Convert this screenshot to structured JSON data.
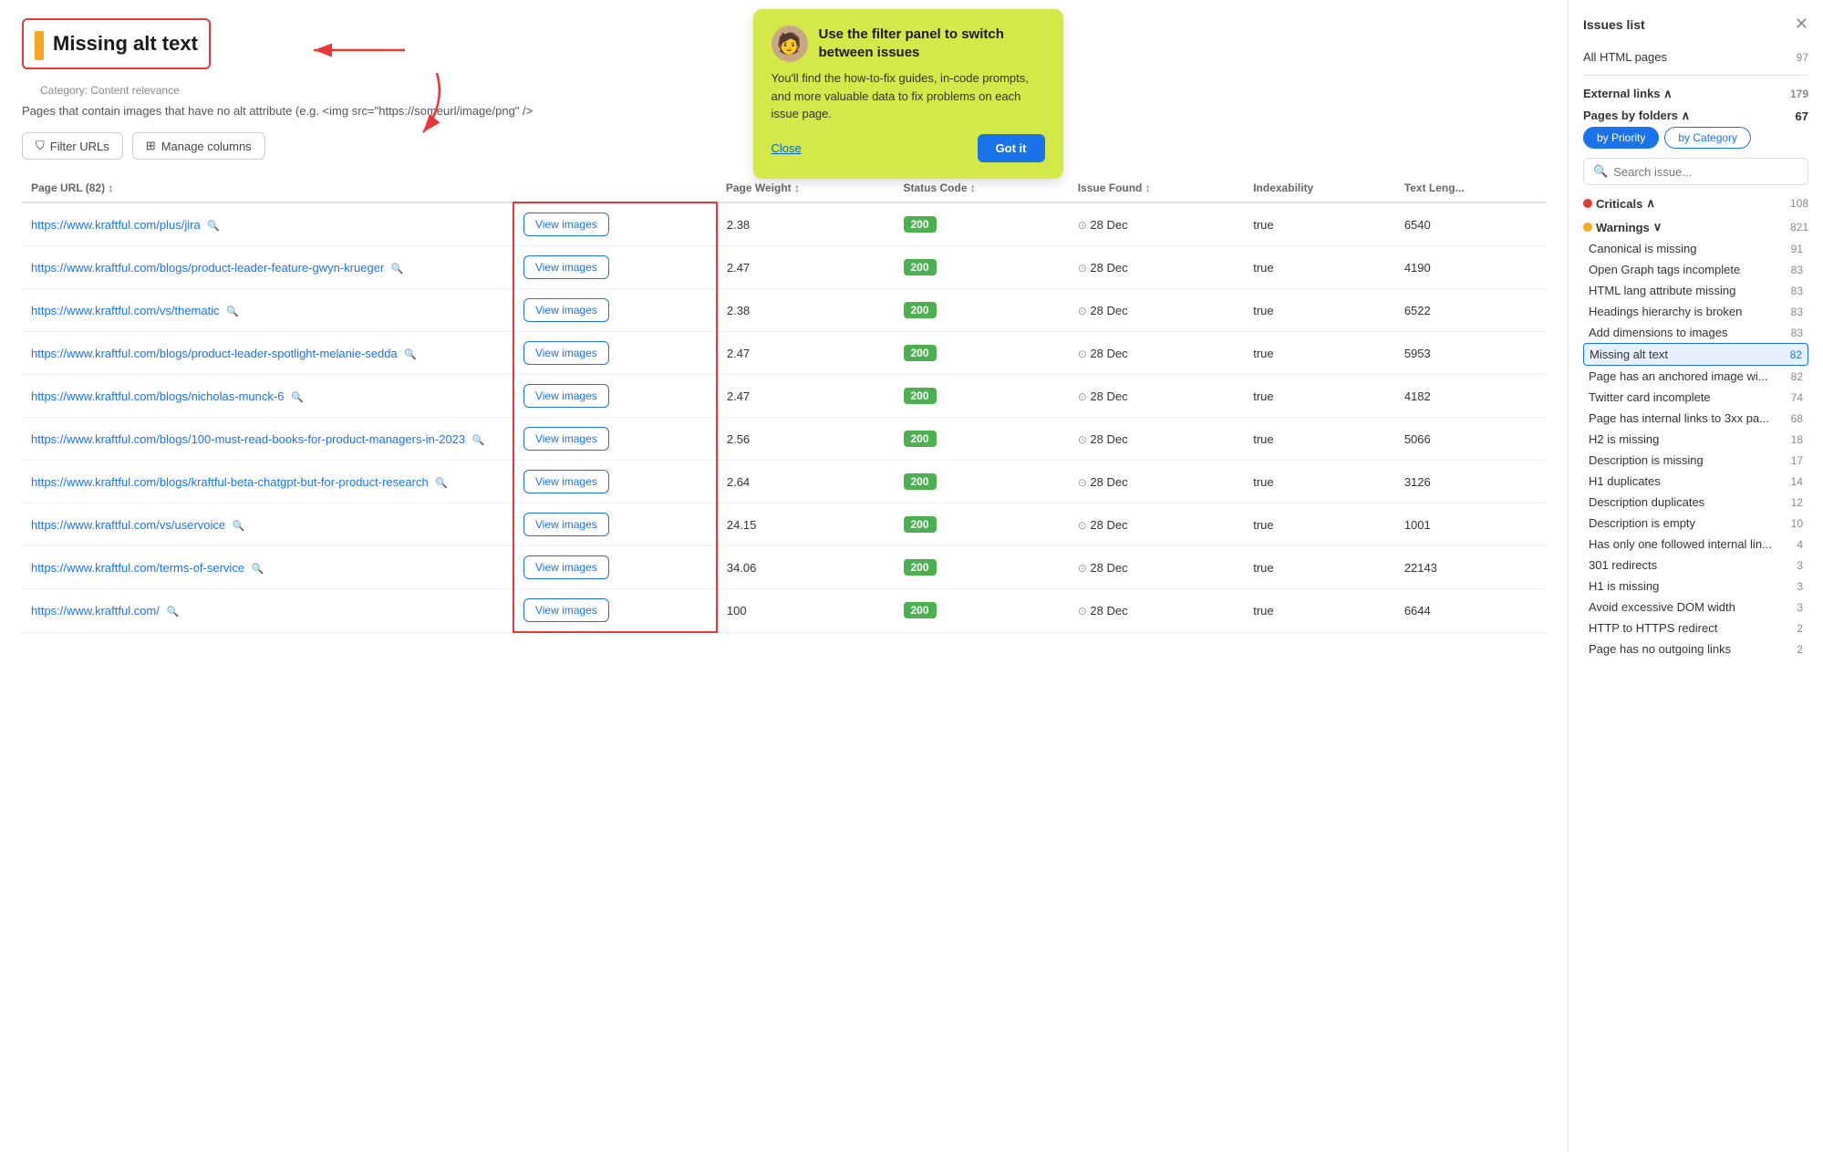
{
  "header": {
    "title": "Missing alt text",
    "category": "Category: Content relevance",
    "description": "Pages that contain images that have no alt attribute (e.g. <img src=\"https://someurl/image/png\" />",
    "url_count": "82"
  },
  "toolbar": {
    "filter_btn": "Filter URLs",
    "manage_btn": "Manage columns"
  },
  "table": {
    "columns": [
      "Page URL (82)",
      "",
      "Page Weight",
      "Status Code",
      "Issue Found",
      "Indexability",
      "Text Length"
    ],
    "rows": [
      {
        "url": "https://www.kraftful.com/plus/jira",
        "weight": "2.38",
        "status": "200",
        "date": "28 Dec",
        "indexable": "true",
        "text": "6540"
      },
      {
        "url": "https://www.kraftful.com/blogs/product-leader-feature-gwyn-krueger",
        "weight": "2.47",
        "status": "200",
        "date": "28 Dec",
        "indexable": "true",
        "text": "4190"
      },
      {
        "url": "https://www.kraftful.com/vs/thematic",
        "weight": "2.38",
        "status": "200",
        "date": "28 Dec",
        "indexable": "true",
        "text": "6522"
      },
      {
        "url": "https://www.kraftful.com/blogs/product-leader-spotlight-melanie-sedda",
        "weight": "2.47",
        "status": "200",
        "date": "28 Dec",
        "indexable": "true",
        "text": "5953"
      },
      {
        "url": "https://www.kraftful.com/blogs/nicholas-munck-6",
        "weight": "2.47",
        "status": "200",
        "date": "28 Dec",
        "indexable": "true",
        "text": "4182"
      },
      {
        "url": "https://www.kraftful.com/blogs/100-must-read-books-for-product-managers-in-2023",
        "weight": "2.56",
        "status": "200",
        "date": "28 Dec",
        "indexable": "true",
        "text": "5066"
      },
      {
        "url": "https://www.kraftful.com/blogs/kraftful-beta-chatgpt-but-for-product-research",
        "weight": "2.64",
        "status": "200",
        "date": "28 Dec",
        "indexable": "true",
        "text": "3126"
      },
      {
        "url": "https://www.kraftful.com/vs/uservoice",
        "weight": "24.15",
        "status": "200",
        "date": "28 Dec",
        "indexable": "true",
        "text": "1001"
      },
      {
        "url": "https://www.kraftful.com/terms-of-service",
        "weight": "34.06",
        "status": "200",
        "date": "28 Dec",
        "indexable": "true",
        "text": "22143"
      },
      {
        "url": "https://www.kraftful.com/",
        "weight": "100",
        "status": "200",
        "date": "28 Dec",
        "indexable": "true",
        "text": "6644"
      }
    ],
    "view_images_label": "View images"
  },
  "tooltip": {
    "title": "Use the filter panel to switch between issues",
    "body": "You'll find the how-to-fix guides, in-code prompts, and more valuable data to fix problems on each issue page.",
    "close_label": "Close",
    "got_it_label": "Got it"
  },
  "sidebar": {
    "title": "Issues list",
    "all_html_label": "All HTML pages",
    "all_html_count": "97",
    "external_links_label": "External links",
    "external_links_count": "179",
    "pages_by_folders_label": "Pages by folders",
    "pages_by_folders_count": "67",
    "filter_tabs": [
      "by Priority",
      "by Category"
    ],
    "search_placeholder": "Search issue...",
    "search_label": "Search issue :",
    "criticals_label": "Criticals",
    "criticals_count": "108",
    "warnings_label": "Warnings",
    "warnings_count": "821",
    "issues": [
      {
        "label": "Canonical is missing",
        "count": "91"
      },
      {
        "label": "Open Graph tags incomplete",
        "count": "83"
      },
      {
        "label": "HTML lang attribute missing",
        "count": "83"
      },
      {
        "label": "Headings hierarchy is broken",
        "count": "83"
      },
      {
        "label": "Add dimensions to images",
        "count": "83"
      },
      {
        "label": "Missing alt text",
        "count": "82",
        "active": true
      },
      {
        "label": "Page has an anchored image wi...",
        "count": "82"
      },
      {
        "label": "Twitter card incomplete",
        "count": "74"
      },
      {
        "label": "Page has internal links to 3xx pa...",
        "count": "68"
      },
      {
        "label": "H2 is missing",
        "count": "18"
      },
      {
        "label": "Description is missing",
        "count": "17"
      },
      {
        "label": "H1 duplicates",
        "count": "14"
      },
      {
        "label": "Description duplicates",
        "count": "12"
      },
      {
        "label": "Description is empty",
        "count": "10"
      },
      {
        "label": "Has only one followed internal lin...",
        "count": "4"
      },
      {
        "label": "301 redirects",
        "count": "3"
      },
      {
        "label": "H1 is missing",
        "count": "3"
      },
      {
        "label": "Avoid excessive DOM width",
        "count": "3"
      },
      {
        "label": "HTTP to HTTPS redirect",
        "count": "2"
      },
      {
        "label": "Page has no outgoing links",
        "count": "2"
      }
    ]
  }
}
